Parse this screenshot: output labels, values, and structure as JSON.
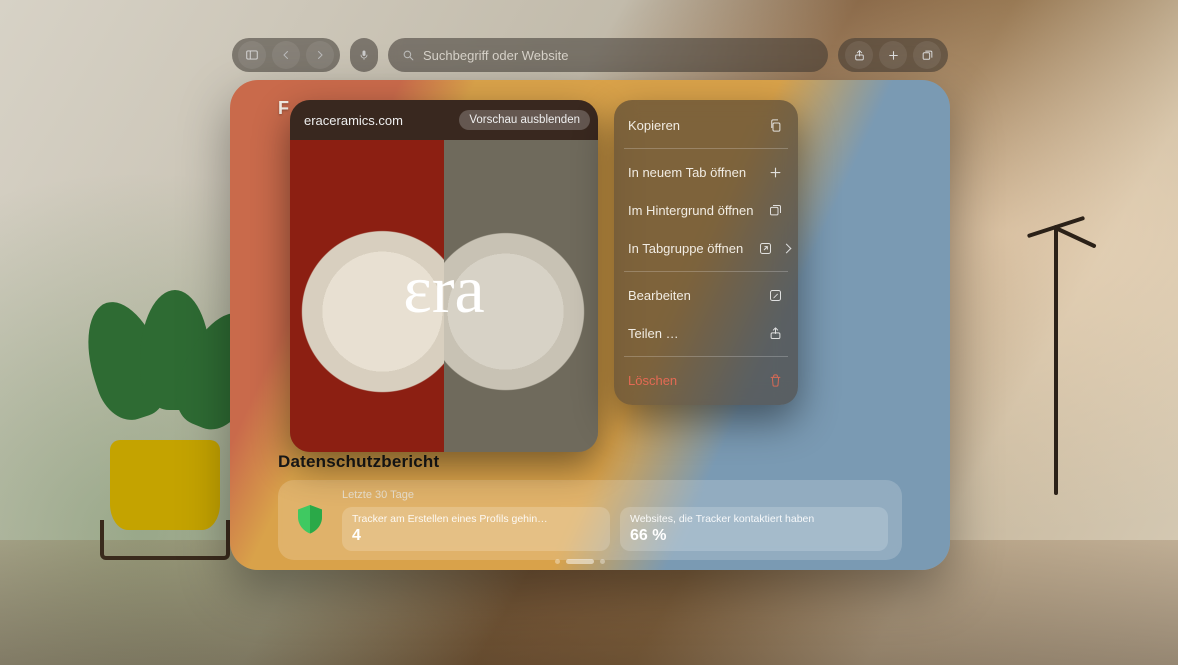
{
  "toolbar": {
    "search_placeholder": "Suchbegriff oder Website"
  },
  "window": {
    "section_label_partial": "F",
    "privacy_title": "Datenschutzbericht"
  },
  "preview": {
    "domain": "eraceramics.com",
    "hide_label": "Vorschau ausblenden",
    "logo_text": "εra"
  },
  "menu": {
    "copy": "Kopieren",
    "open_new_tab": "In neuem Tab öffnen",
    "open_background": "Im Hintergrund öffnen",
    "open_tabgroup": "In Tabgruppe öffnen",
    "edit": "Bearbeiten",
    "share": "Teilen …",
    "delete": "Löschen"
  },
  "privacy": {
    "period": "Letzte 30 Tage",
    "tile1_label": "Tracker am Erstellen eines Profils gehin…",
    "tile1_value": "4",
    "tile2_label": "Websites, die Tracker kontaktiert haben",
    "tile2_value": "66 %"
  }
}
